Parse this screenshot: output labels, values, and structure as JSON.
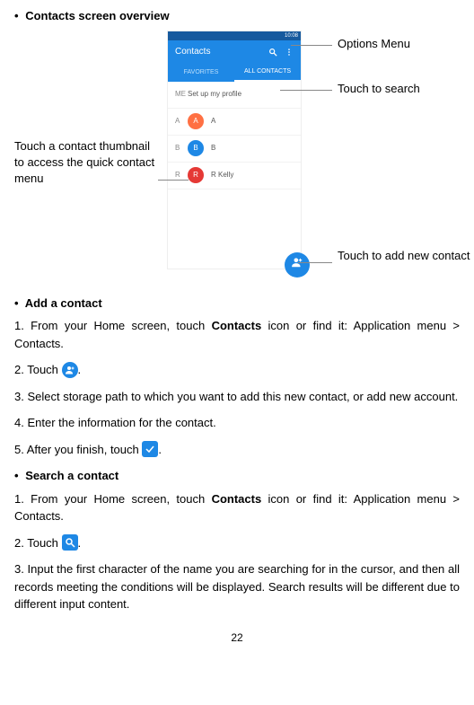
{
  "overview": {
    "heading_prefix": "•",
    "heading": "Contacts screen overview",
    "callouts": {
      "options": "Options Menu",
      "search": "Touch to search",
      "thumbnail": "Touch a contact thumbnail to access the quick contact menu",
      "add": "Touch to add new contact"
    },
    "phone": {
      "status": "10:08",
      "title": "Contacts",
      "tabs": {
        "fav": "FAVORITES",
        "all": "ALL CONTACTS"
      },
      "rows": {
        "me": {
          "letter": "ME",
          "label": "Set up my profile"
        },
        "a": {
          "letter": "A",
          "avatar": "A",
          "label": "A"
        },
        "b": {
          "letter": "B",
          "avatar": "B",
          "label": "B"
        },
        "r": {
          "letter": "R",
          "avatar": "R",
          "label": "R Kelly"
        }
      }
    }
  },
  "addContact": {
    "heading_prefix": "•",
    "heading": "Add a contact",
    "step1_a": "1. From your Home screen, touch ",
    "step1_bold": "Contacts",
    "step1_b": " icon or find it: Application menu > Contacts.",
    "step2_a": "2. Touch ",
    "step2_b": ".",
    "step3": "3. Select storage path to which you want to add this new contact, or add new account.",
    "step4": "4. Enter the information for the contact.",
    "step5_a": "5. After you finish, touch ",
    "step5_b": "."
  },
  "searchContact": {
    "heading_prefix": "•",
    "heading": "Search a contact",
    "step1_a": "1. From your Home screen, touch ",
    "step1_bold": "Contacts",
    "step1_b": " icon or find it: Application menu > Contacts.",
    "step2_a": "2. Touch ",
    "step2_b": ".",
    "step3": "3. Input the first character of the name you are searching for in the cursor, and then all records meeting the conditions will be displayed. Search results will be different due to different input content."
  },
  "icons": {
    "addPerson": "+",
    "check": "✓",
    "search": "⌕",
    "menu": "⋮",
    "fab": "+"
  },
  "pageNumber": "22"
}
